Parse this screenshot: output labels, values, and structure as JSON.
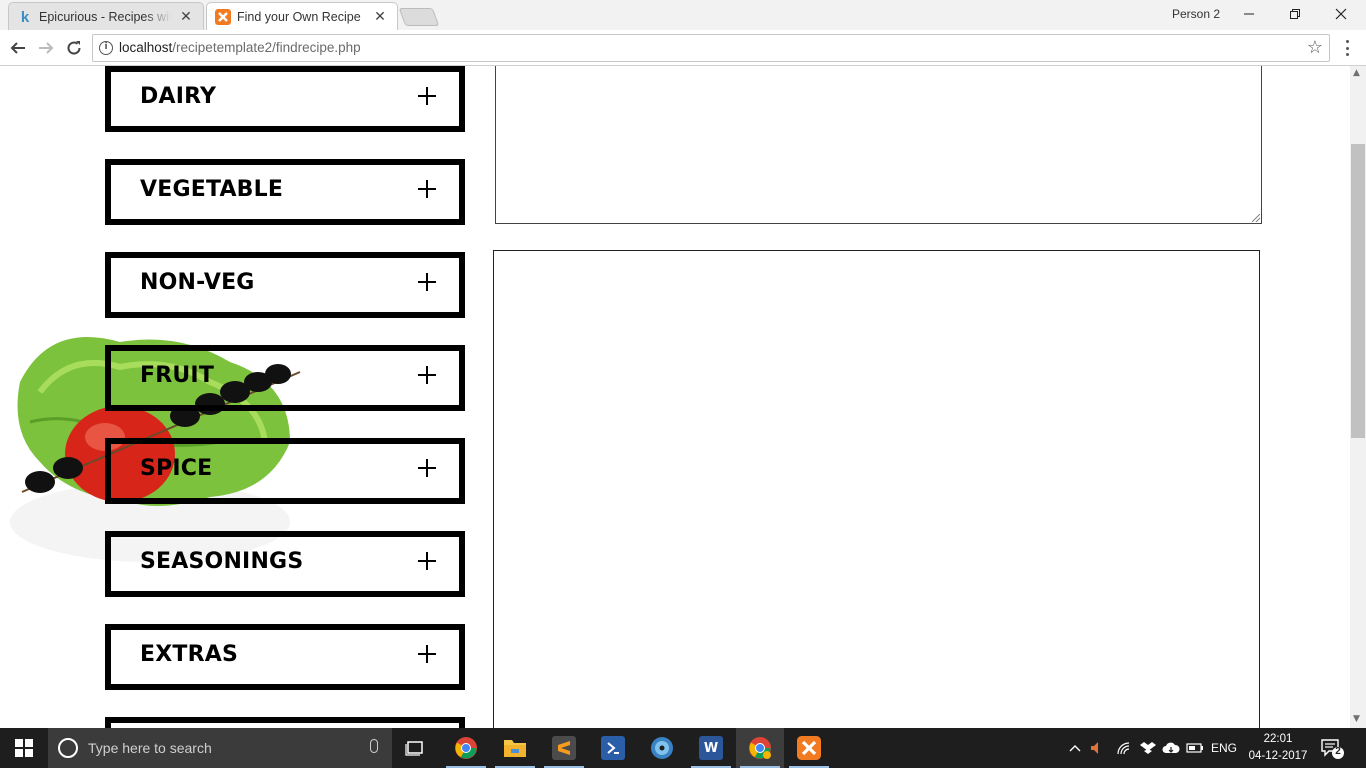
{
  "browser": {
    "tabs": [
      {
        "title": "Epicurious - Recipes with",
        "favicon": "k",
        "active": false
      },
      {
        "title": "Find your Own Recipe",
        "favicon": "xampp",
        "active": true
      }
    ],
    "profile": "Person 2",
    "url_host": "localhost",
    "url_path": "/recipetemplate2/findrecipe.php"
  },
  "page": {
    "categories": [
      {
        "label": "DAIRY"
      },
      {
        "label": "VEGETABLE"
      },
      {
        "label": "NON-VEG"
      },
      {
        "label": "FRUIT"
      },
      {
        "label": "SPICE"
      },
      {
        "label": "SEASONINGS"
      },
      {
        "label": "EXTRAS"
      },
      {
        "label": ""
      }
    ],
    "expand_icon": "plus-icon"
  },
  "taskbar": {
    "search_placeholder": "Type here to search",
    "apps": [
      "task-view-icon",
      "chrome-icon",
      "file-explorer-icon",
      "sublime-text-icon",
      "powershell-icon",
      "disc-burner-icon",
      "word-icon",
      "chrome-canary-icon",
      "xampp-icon"
    ],
    "language": "ENG",
    "time": "22:01",
    "date": "04-12-2017",
    "notification_count": "2"
  }
}
